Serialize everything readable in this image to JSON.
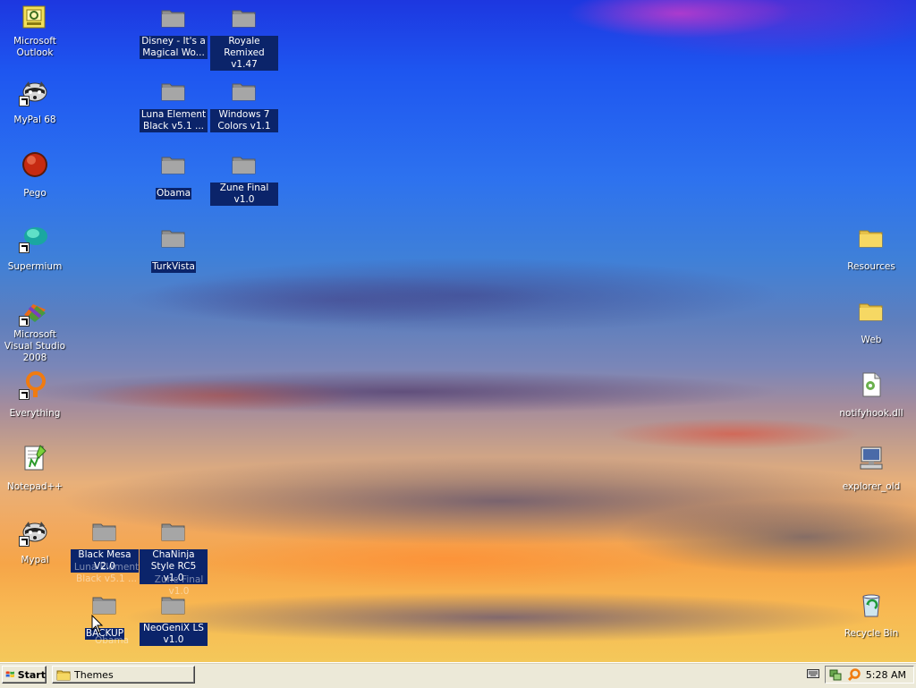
{
  "desktop": {
    "icons": {
      "outlook": "Microsoft Outlook",
      "mypal68": "MyPal 68",
      "pego": "Pego",
      "supermium": "Supermium",
      "visual_studio": "Microsoft Visual Studio 2008",
      "everything": "Everything",
      "notepadpp": "Notepad++",
      "mypal": "Mypal",
      "disney": "Disney - It's a Magical Wo...",
      "royale": "Royale Remixed v1.47",
      "luna_element": "Luna Element Black v5.1 ...",
      "windows7": "Windows 7 Colors v1.1",
      "obama": "Obama",
      "zune": "Zune Final v1.0",
      "turkvista": "TurkVista",
      "black_mesa": "Black Mesa V2.0",
      "chaninja": "ChaNinja Style RC5 v1.0",
      "backup": "BACKUP",
      "neogenix": "NeoGeniX LS v1.0",
      "resources": "Resources",
      "web": "Web",
      "notifyhook": "notifyhook.dll",
      "explorer_old": "explorer_old",
      "recycle_bin": "Recycle Bin"
    },
    "drag_ghost": {
      "luna": "Luna Element Black v5.1 ...",
      "obama": "Obama",
      "zune": "Zune Final v1.0"
    }
  },
  "taskbar": {
    "start_label": "Start",
    "tasks": [
      {
        "label": "Themes"
      }
    ],
    "clock": "5:28 AM"
  },
  "colors": {
    "selection": "#0b246a",
    "taskbar": "#ece9d8",
    "folder_dim": "#8e8e8e",
    "folder_yellow": "#f6d863"
  }
}
